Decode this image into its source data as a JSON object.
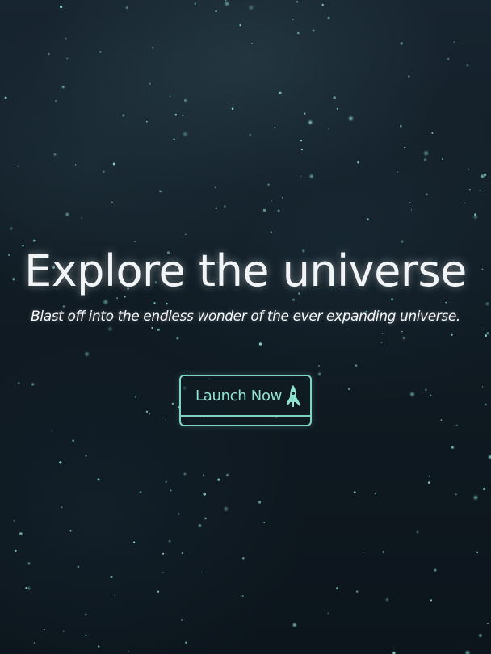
{
  "hero": {
    "title": "Explore the universe",
    "subtitle": "Blast off into the endless wonder of the ever expanding universe."
  },
  "cta": {
    "label": "Launch Now",
    "icon": "rocket-icon"
  },
  "colors": {
    "background": "#0f1a22",
    "accent": "#7fd3c4",
    "star": "#9fe8dc",
    "text": "#f2f5f7"
  }
}
